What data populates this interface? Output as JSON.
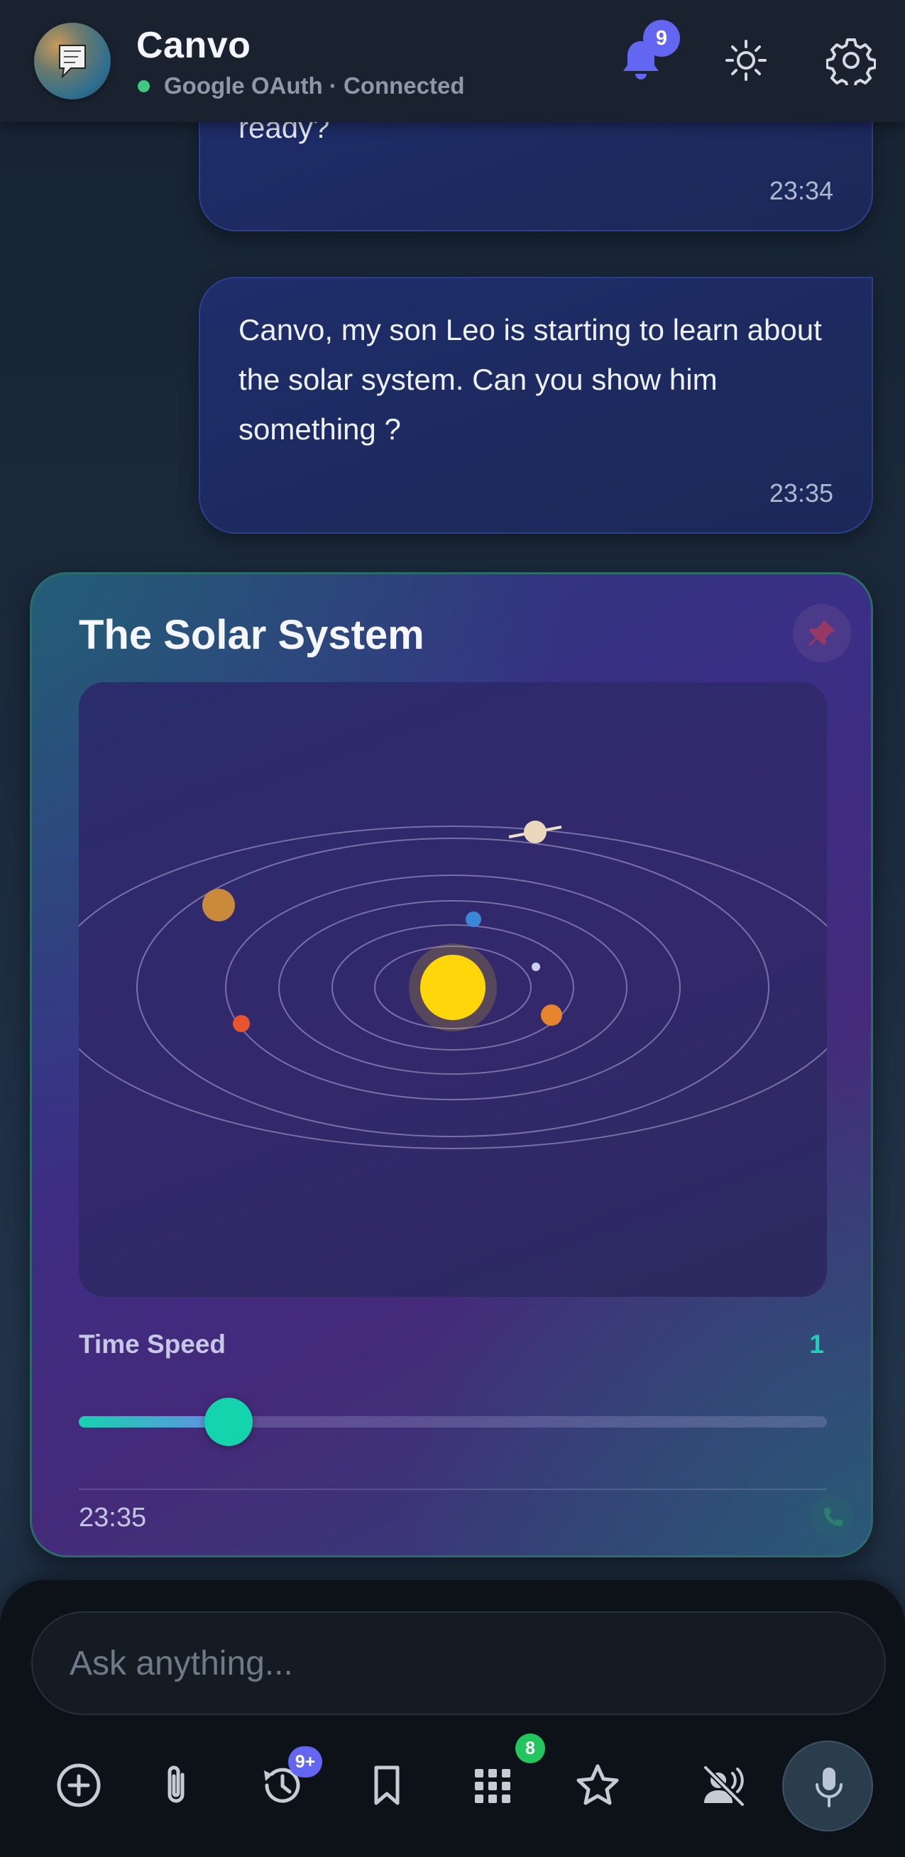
{
  "header": {
    "app_title": "Canvo",
    "status": "Google OAuth · Connected",
    "notification_count": "9"
  },
  "messages": [
    {
      "text_partial": "ready?",
      "time": "23:34"
    },
    {
      "text": "Canvo, my son Leo is starting to learn about the solar system. Can you show him something ?",
      "time": "23:35"
    }
  ],
  "card": {
    "title": "The Solar System",
    "speed_label": "Time Speed",
    "speed_value": "1",
    "speed_fraction": 0.2,
    "time": "23:35"
  },
  "composer": {
    "placeholder": "Ask anything...",
    "history_badge": "9+",
    "apps_badge": "8"
  },
  "icons": {
    "header": [
      "notifications-bell-icon",
      "theme-sun-icon",
      "settings-gear-icon"
    ],
    "toolbar": [
      "add-circle-icon",
      "attach-paperclip-icon",
      "history-icon",
      "bookmark-icon",
      "apps-grid-icon",
      "star-icon",
      "voice-off-icon",
      "microphone-icon"
    ]
  },
  "colors": {
    "accent": "#6366f1",
    "status_online": "#3fc97f",
    "slider": "#14d4ad",
    "sun": "#ffd60a"
  }
}
